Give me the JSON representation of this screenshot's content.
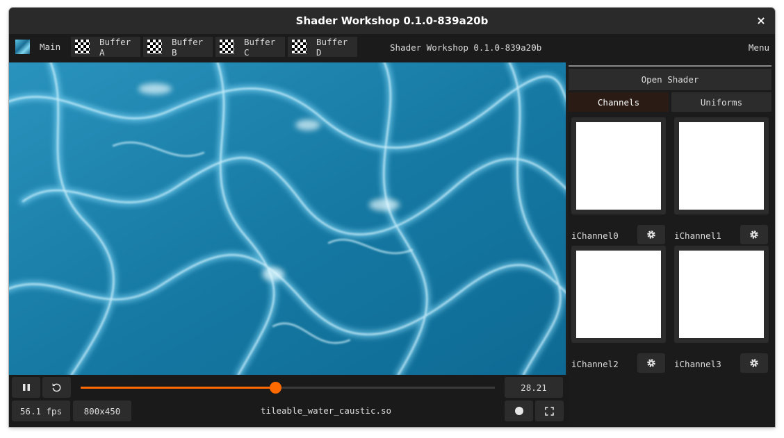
{
  "window": {
    "title": "Shader Workshop 0.1.0-839a20b",
    "close_glyph": "×"
  },
  "tabs": [
    {
      "label": "Main",
      "thumb": "water"
    },
    {
      "label": "Buffer A",
      "thumb": "checker"
    },
    {
      "label": "Buffer B",
      "thumb": "checker"
    },
    {
      "label": "Buffer C",
      "thumb": "checker"
    },
    {
      "label": "Buffer D",
      "thumb": "checker"
    }
  ],
  "tabbar": {
    "title": "Shader Workshop 0.1.0-839a20b",
    "menu_label": "Menu"
  },
  "playback": {
    "time": "28.21",
    "progress": 0.47,
    "fps": "56.1 fps",
    "resolution": "800x450",
    "filename": "tileable_water_caustic.so"
  },
  "sidebar": {
    "open_shader_label": "Open Shader",
    "tabs": {
      "channels": "Channels",
      "uniforms": "Uniforms"
    },
    "channels": [
      {
        "label": "iChannel0"
      },
      {
        "label": "iChannel1"
      },
      {
        "label": "iChannel2"
      },
      {
        "label": "iChannel3"
      }
    ]
  },
  "colors": {
    "accent": "#ff6a00",
    "water_base": "#1a7fa8",
    "panel": "#2c2c2c",
    "background": "#1b1b1b"
  },
  "icons": [
    "close-icon",
    "water-thumbnail-icon",
    "checker-thumbnail-icon",
    "pause-icon",
    "restart-icon",
    "record-icon",
    "fullscreen-icon",
    "gear-icon"
  ]
}
